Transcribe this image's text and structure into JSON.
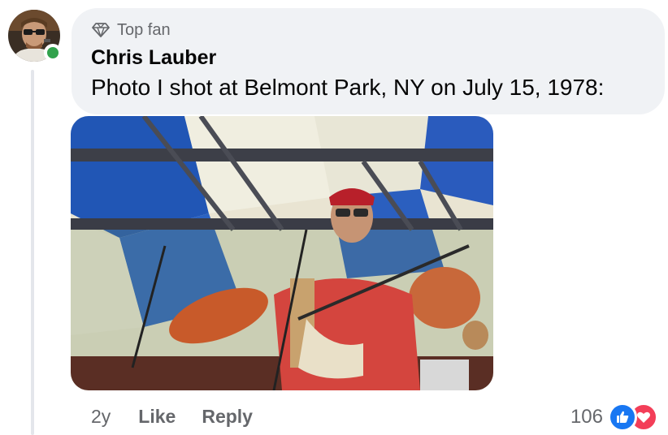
{
  "comment": {
    "badge": "Top fan",
    "author": "Chris Lauber",
    "text": "Photo I shot at Belmont Park, NY on July 15, 1978:",
    "online": true
  },
  "actions": {
    "time": "2y",
    "like_label": "Like",
    "reply_label": "Reply"
  },
  "reactions": {
    "count": "106",
    "types": [
      "like-icon",
      "love-icon"
    ]
  },
  "colors": {
    "bubble": "#f0f2f5",
    "secondary_text": "#65676b",
    "online": "#31a24c",
    "like": "#1877f2",
    "love": "#f33e58"
  }
}
